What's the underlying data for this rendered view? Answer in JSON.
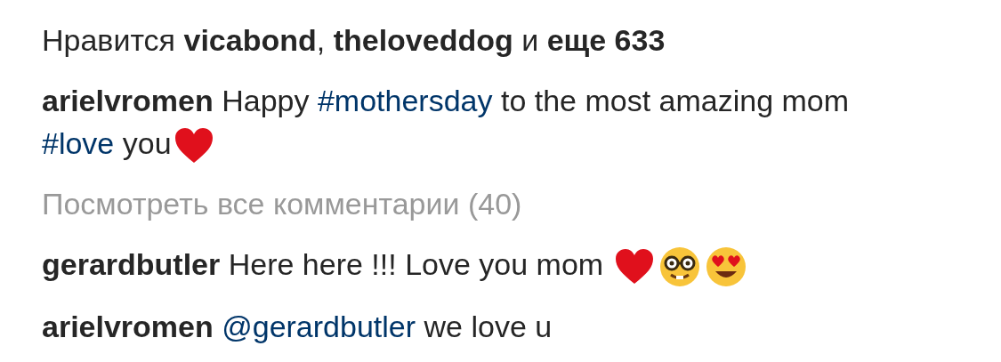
{
  "likes": {
    "text": "Нравится **vicabond**, **theloveddog** и **еще 633**"
  },
  "caption": {
    "username": "arielvromen",
    "parts": [
      {
        "kind": "text",
        "text": "Happy "
      },
      {
        "kind": "hashtag",
        "text": "#mothersday"
      },
      {
        "kind": "text",
        "text": " to the most amazing mom "
      },
      {
        "kind": "hashtag",
        "text": "#love"
      },
      {
        "kind": "text",
        "text": " you"
      },
      {
        "kind": "heart"
      }
    ]
  },
  "view_all_comments": "Посмотреть все комментарии (40)",
  "comments": [
    {
      "username": "gerardbutler",
      "parts": [
        {
          "kind": "text",
          "text": "Here here !!! Love you mom "
        },
        {
          "kind": "heart"
        },
        {
          "kind": "nerd"
        },
        {
          "kind": "heart_eyes"
        }
      ]
    },
    {
      "username": "arielvromen",
      "parts": [
        {
          "kind": "mention",
          "text": "@gerardbutler"
        },
        {
          "kind": "text",
          "text": " we love u"
        }
      ]
    }
  ]
}
